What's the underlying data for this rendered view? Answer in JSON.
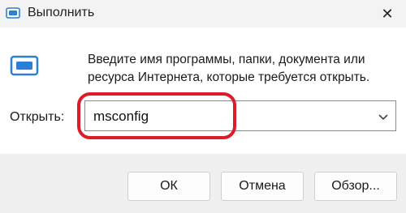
{
  "window": {
    "title": "Выполнить",
    "close_glyph": "✕",
    "title_icon": "run-icon"
  },
  "content": {
    "icon": "run-icon",
    "description": "Введите имя программы, папки, документа или ресурса Интернета, которые требуется открыть.",
    "open_label": "Открыть:",
    "input_value": "msconfig",
    "dropdown_icon": "chevron-down-icon"
  },
  "buttons": {
    "ok": "ОК",
    "cancel": "Отмена",
    "browse": "Обзор..."
  },
  "colors": {
    "highlight": "#dd1c2a",
    "icon_blue": "#2b7fd6"
  }
}
